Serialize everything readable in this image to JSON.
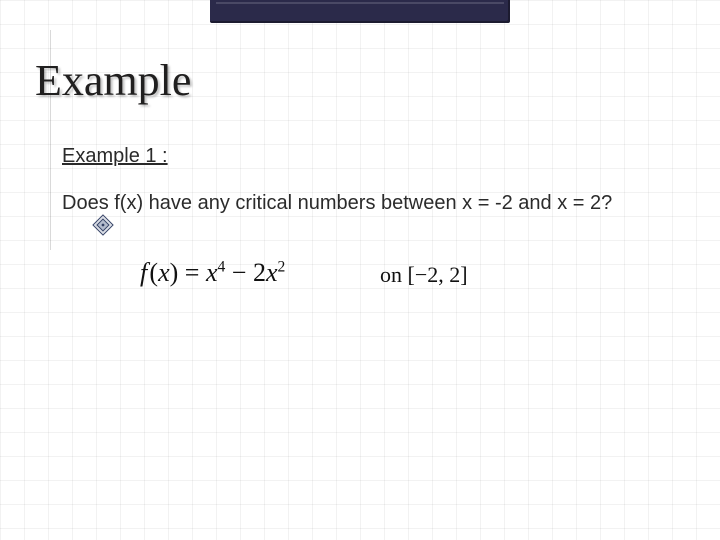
{
  "title": "Example",
  "example_label": "Example 1 :",
  "question": "Does f(x) have any critical numbers between x = -2 and x = 2?",
  "formula_text": "f(x) = x⁴ − 2x²",
  "domain_prefix": "on",
  "interval": "[−2, 2]",
  "bullet_icon_name": "compass-bullet-icon",
  "colors": {
    "title_bar": "#2b2a4a"
  }
}
